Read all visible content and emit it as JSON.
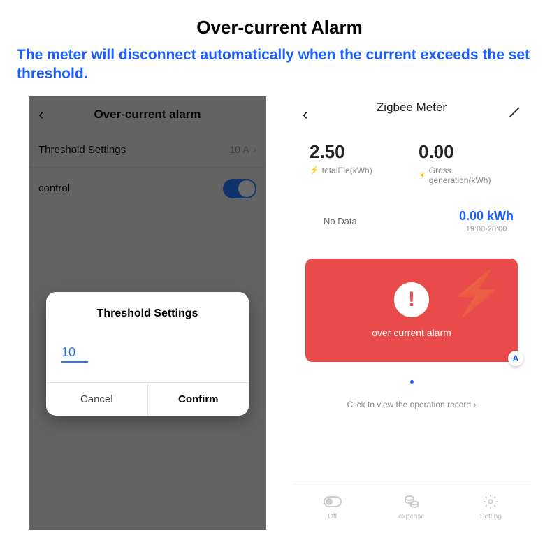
{
  "header": {
    "title": "Over-current Alarm",
    "subtitle": "The meter will disconnect automatically when the current exceeds the set threshold."
  },
  "left": {
    "title": "Over-current alarm",
    "threshold_label": "Threshold Settings",
    "threshold_value": "10 A",
    "control_label": "control",
    "dialog": {
      "title": "Threshold Settings",
      "input_value": "10",
      "cancel": "Cancel",
      "confirm": "Confirm"
    }
  },
  "right": {
    "title": "Zigbee Meter",
    "metric1": {
      "value": "2.50",
      "label": "totalEle(kWh)"
    },
    "metric2": {
      "value": "0.00",
      "label": "Gross generation(kWh)"
    },
    "nodata": "No Data",
    "kwh": {
      "value": "0.00 kWh",
      "time": "19:00-20:00"
    },
    "alarm_text": "over current alarm",
    "alarm_badge": "A",
    "record_link": "Click to view the operation record  ›",
    "tabs": {
      "off": "Off",
      "expense": "expense",
      "setting": "Setting"
    }
  }
}
